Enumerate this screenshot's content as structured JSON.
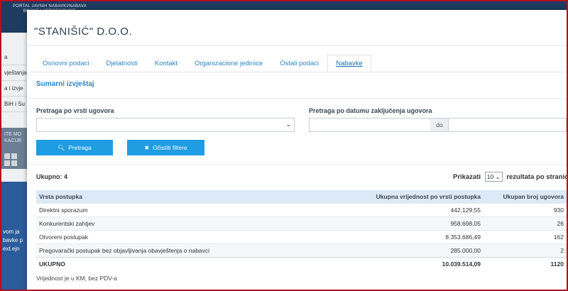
{
  "portal": {
    "title_line1": "PORTAL JAVNIH NABAVKI/NABAVA",
    "title_line2": "BOSNE I HERCEGOVINE"
  },
  "sidebar_fragments": [
    "a",
    "vještanja",
    "a i izvje",
    "BiH i Su"
  ],
  "sidebar_dark_fragments": [
    "ITE MO",
    "KACIJE"
  ],
  "sidebar_blue_fragments": [
    "vom ja",
    "bavke p",
    "ext.ejn"
  ],
  "modal": {
    "title": "\"STANIŠIĆ\" D.O.O.",
    "tabs": [
      {
        "label": "Osnovni podaci",
        "active": false
      },
      {
        "label": "Djelatnosti",
        "active": false
      },
      {
        "label": "Kontakt",
        "active": false
      },
      {
        "label": "Organizacione jedinice",
        "active": false
      },
      {
        "label": "Ostali podaci",
        "active": false
      },
      {
        "label": "Nabavke",
        "active": true
      }
    ],
    "section_title": "Sumarni izvještaj",
    "filters": {
      "contract_type_label": "Pretraga po vrsti ugovora",
      "contract_type_value": "",
      "date_label": "Pretraga po datumu zaključenja ugovora",
      "date_from": "",
      "date_sep": "do",
      "date_to": ""
    },
    "buttons": {
      "search": "Pretraga",
      "clear": "Očistiti filtere"
    },
    "total_label": "Ukupno: 4",
    "page_size": {
      "prefix": "Prikazati",
      "value": "10",
      "suffix": "rezultata po stranici"
    },
    "table": {
      "headers": [
        "Vrsta postupka",
        "Ukupna vrijednost po vrsti postupka",
        "Ukupan broj ugovora"
      ],
      "rows": [
        [
          "Direktni sporazum",
          "442.129,55",
          "930"
        ],
        [
          "Konkurentski zahtjev",
          "958.698,05",
          "26"
        ],
        [
          "Otvoreni postupak",
          "8.353.686,49",
          "162"
        ],
        [
          "Pregovarački postupak bez objavljivanja obavještenja o nabavci",
          "285.000,00",
          "2"
        ]
      ],
      "total_row": [
        "UKUPNO",
        "10.039.514,09",
        "1120"
      ]
    },
    "note": "Vrijednost je u KM, bez PDV-a"
  },
  "colors": {
    "accent": "#1e9de3",
    "header_bg": "#dbeaf6",
    "frame": "#b01020"
  }
}
